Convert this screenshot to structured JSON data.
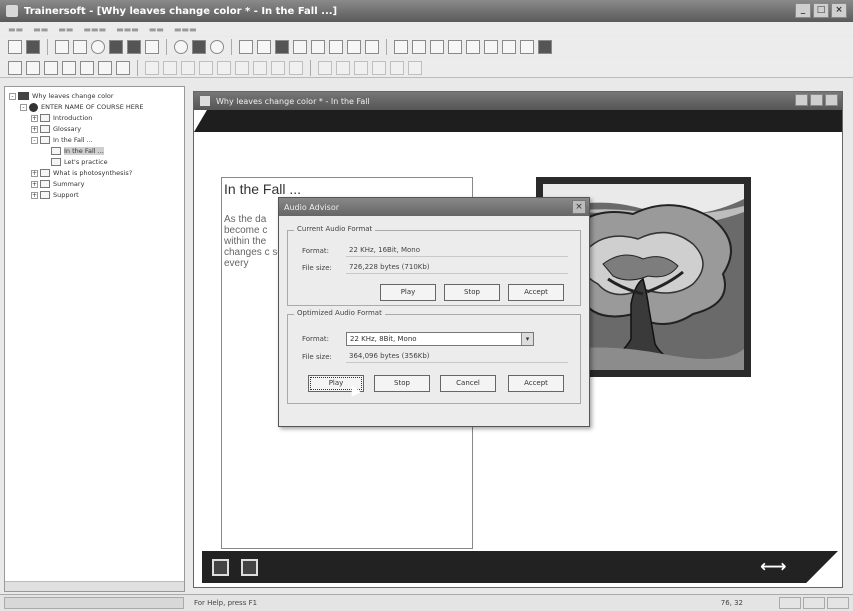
{
  "app": {
    "title": "Trainersoft - [Why leaves change color * - In the Fall ...]"
  },
  "doc_window": {
    "title": "Why leaves change color * - In the Fall"
  },
  "tree": {
    "items": [
      {
        "label": "Why leaves change color",
        "level": 0,
        "icon": "book-icon",
        "expander": "-"
      },
      {
        "label": "ENTER NAME OF COURSE HERE",
        "level": 1,
        "icon": "globe-icon",
        "expander": "-"
      },
      {
        "label": "Introduction",
        "level": 2,
        "icon": "page-icon",
        "expander": "+"
      },
      {
        "label": "Glossary",
        "level": 2,
        "icon": "page-icon",
        "expander": "+"
      },
      {
        "label": "In the Fall ...",
        "level": 2,
        "icon": "page-icon",
        "expander": "-"
      },
      {
        "label": "In the Fall ...",
        "level": 3,
        "icon": "page-icon",
        "expander": "",
        "selected": true
      },
      {
        "label": "Let's practice",
        "level": 3,
        "icon": "page-icon",
        "expander": ""
      },
      {
        "label": "What is photosynthesis?",
        "level": 2,
        "icon": "page-icon",
        "expander": "+"
      },
      {
        "label": "Summary",
        "level": 2,
        "icon": "page-icon",
        "expander": "+"
      },
      {
        "label": "Support",
        "level": 2,
        "icon": "page-icon",
        "expander": "+"
      }
    ]
  },
  "lesson": {
    "heading": "In the Fall ...",
    "body": "As the da become c within the changes c see every"
  },
  "dialog": {
    "title": "Audio Advisor",
    "current_group": "Current Audio Format",
    "current_format_label": "Format:",
    "current_format_value": "22 KHz, 16Bit, Mono",
    "current_size_label": "File size:",
    "current_size_value": "726,228 bytes (710Kb)",
    "optimized_group": "Optimized Audio Format",
    "optimized_format_label": "Format:",
    "optimized_format_value": "22 KHz, 8Bit, Mono",
    "optimized_size_label": "File size:",
    "optimized_size_value": "364,096 bytes (356Kb)",
    "play_label": "Play",
    "stop_label": "Stop",
    "accept_label": "Accept",
    "cancel_label": "Cancel"
  },
  "status": {
    "help_text": "For Help, press F1",
    "position": "76, 32"
  }
}
